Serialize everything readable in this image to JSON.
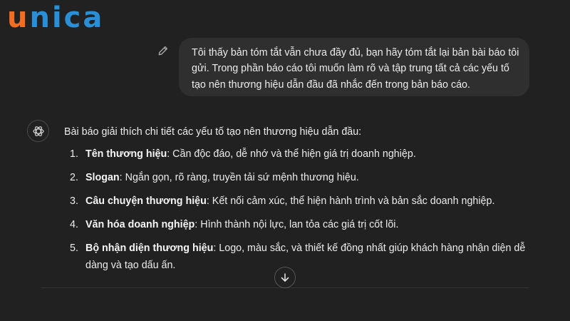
{
  "logo": {
    "first_letter": "u",
    "rest": "nica"
  },
  "user_message": {
    "text": "Tôi thấy bản tóm tắt vẫn chưa đầy đủ, bạn hãy tóm tắt lại bản bài báo tôi gửi. Trong phần báo cáo tôi muốn làm rõ và tập trung tất cả các yếu tố tạo nên thương hiệu dẫn đầu đã nhắc đến trong bản báo cáo."
  },
  "assistant_message": {
    "intro": "Bài báo giải thích chi tiết các yếu tố tạo nên thương hiệu dẫn đầu:",
    "items": [
      {
        "number": "1.",
        "term": "Tên thương hiệu",
        "text": ": Cần độc đáo, dễ nhớ và thể hiện giá trị doanh nghiệp."
      },
      {
        "number": "2.",
        "term": "Slogan",
        "text": ": Ngắn gọn, rõ ràng, truyền tải sứ mệnh thương hiệu."
      },
      {
        "number": "3.",
        "term": "Câu chuyện thương hiệu",
        "text": ": Kết nối cảm xúc, thể hiện hành trình và bản sắc doanh nghiệp."
      },
      {
        "number": "4.",
        "term": "Văn hóa doanh nghiệp",
        "text": ": Hình thành nội lực, lan tỏa các giá trị cốt lõi."
      },
      {
        "number": "5.",
        "term": "Bộ nhận diện thương hiệu",
        "text": ": Logo, màu sắc, và thiết kế đồng nhất giúp khách hàng nhận diện dễ dàng và tạo dấu ấn."
      }
    ]
  },
  "icons": {
    "edit": "pencil-icon",
    "avatar": "openai-logo-icon",
    "scroll": "arrow-down-icon"
  },
  "colors": {
    "background": "#212121",
    "bubble": "#2f2f2f",
    "text": "#ececec",
    "logo_orange": "#f26d21",
    "logo_blue": "#2a8fd6"
  }
}
